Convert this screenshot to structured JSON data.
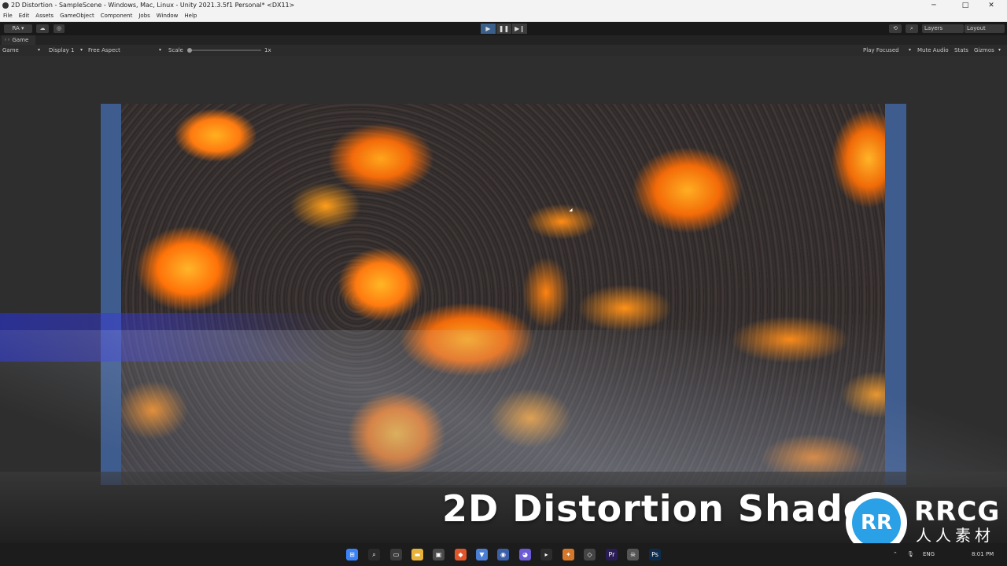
{
  "window": {
    "title": "2D Distortion - SampleScene - Windows, Mac, Linux - Unity 2021.3.5f1 Personal* <DX11>",
    "controls": [
      "─",
      "□",
      "✕"
    ]
  },
  "menu": [
    "File",
    "Edit",
    "Assets",
    "GameObject",
    "Component",
    "Jobs",
    "Window",
    "Help"
  ],
  "toolbar": {
    "account_label": "RA ▾",
    "play": "▶",
    "pause": "❚❚",
    "step": "▶❙",
    "layers_label": "Layers",
    "layout_label": "Layout"
  },
  "tab": {
    "label": "Game"
  },
  "gamebar": {
    "mode": "Game",
    "display": "Display 1",
    "aspect": "Free Aspect",
    "scale_label": "Scale",
    "scale_value": "1x",
    "play_focused": "Play Focused",
    "mute_audio": "Mute Audio",
    "stats": "Stats",
    "gizmos": "Gizmos"
  },
  "overlay": {
    "title": "2D Distortion Shader"
  },
  "watermark": {
    "brand": "RRCG",
    "sub": "人人素材",
    "logo_text": "RR"
  },
  "tray": {
    "lang": "ENG",
    "time": "8:01 PM"
  },
  "colors": {
    "frame_blue": "#3f5c8e",
    "lava_orange": "#ff9a1a",
    "play_active": "#3a5f8a"
  }
}
